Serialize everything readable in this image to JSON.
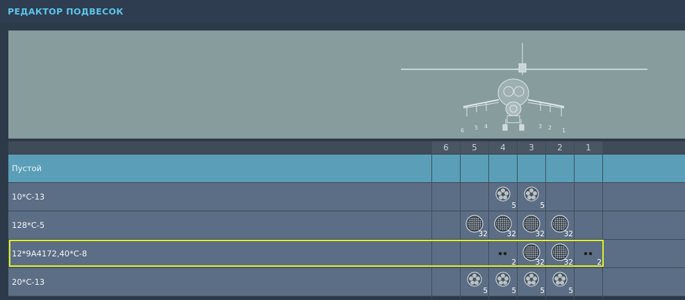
{
  "window": {
    "title": "РЕДАКТОР ПОДВЕСОК"
  },
  "preview": {
    "pylon_labels": [
      "6",
      "5",
      "4",
      "3",
      "2",
      "1"
    ]
  },
  "table": {
    "pylon_headers": [
      "6",
      "5",
      "4",
      "3",
      "2",
      "1"
    ],
    "rows": [
      {
        "name": "Пустой",
        "selected": true,
        "cells": []
      },
      {
        "name": "10*С-13",
        "selected": false,
        "cells": [
          {
            "pylon": "4",
            "icon": "rocket-pod-5-icon",
            "count": "5"
          },
          {
            "pylon": "3",
            "icon": "rocket-pod-5-icon",
            "count": "5"
          }
        ]
      },
      {
        "name": "128*С-5",
        "selected": false,
        "cells": [
          {
            "pylon": "5",
            "icon": "rocket-pod-32-icon",
            "count": "32"
          },
          {
            "pylon": "4",
            "icon": "rocket-pod-32-icon",
            "count": "32"
          },
          {
            "pylon": "3",
            "icon": "rocket-pod-32-icon",
            "count": "32"
          },
          {
            "pylon": "2",
            "icon": "rocket-pod-32-icon",
            "count": "32"
          }
        ]
      },
      {
        "name": "12*9А4172,40*С-8",
        "selected": false,
        "highlighted": true,
        "cells": [
          {
            "pylon": "4",
            "icon": "missile-pair-icon",
            "count": "2"
          },
          {
            "pylon": "3",
            "icon": "rocket-pod-32-icon",
            "count": "32"
          },
          {
            "pylon": "2",
            "icon": "rocket-pod-32-icon",
            "count": "32"
          },
          {
            "pylon": "1",
            "icon": "missile-pair-icon",
            "count": "2"
          }
        ]
      },
      {
        "name": "20*С-13",
        "selected": false,
        "cells": [
          {
            "pylon": "5",
            "icon": "rocket-pod-5-icon",
            "count": "5"
          },
          {
            "pylon": "4",
            "icon": "rocket-pod-5-icon",
            "count": "5"
          },
          {
            "pylon": "3",
            "icon": "rocket-pod-5-icon",
            "count": "5"
          },
          {
            "pylon": "2",
            "icon": "rocket-pod-5-icon",
            "count": "5"
          }
        ]
      }
    ]
  },
  "colors": {
    "title": "#5cc4ea",
    "selected_row": "#5a9fb7",
    "row": "#5c6e85",
    "highlight": "#e6f020"
  }
}
